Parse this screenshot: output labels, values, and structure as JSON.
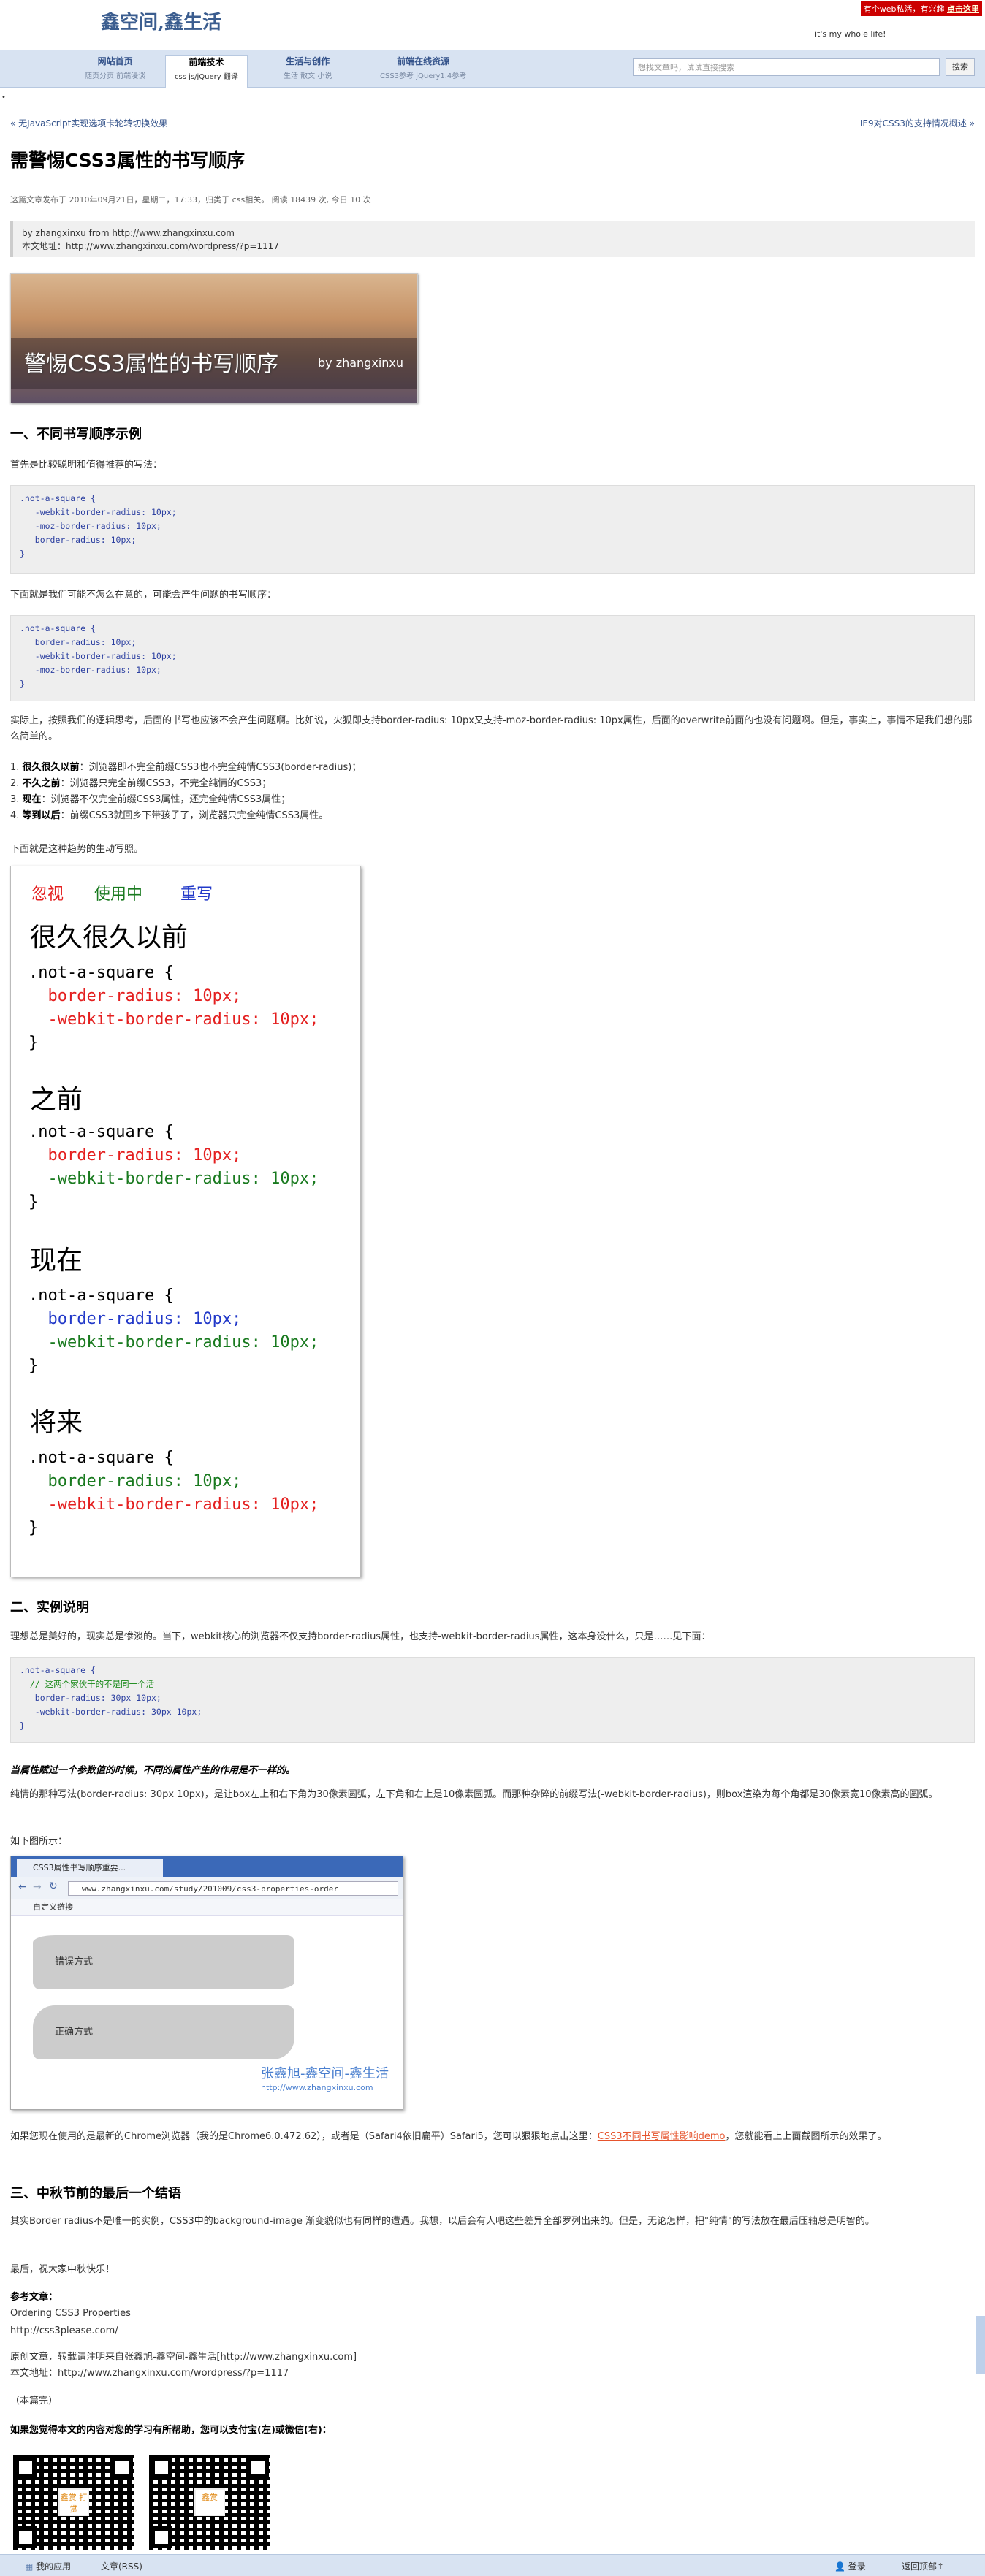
{
  "header": {
    "logo_text": "鑫空间,鑫生活",
    "promo_text": "有个web私活，有兴趣",
    "promo_link": "点击这里",
    "slogan": "it's my whole life!",
    "nav": [
      {
        "title": "网站首页",
        "sub": "随页分页  前端漫谈"
      },
      {
        "title": "前端技术",
        "sub": "css  js/jQuery  翻译"
      },
      {
        "title": "生活与创作",
        "sub": "生活  散文  小说"
      },
      {
        "title": "前端在线资源",
        "sub": "CSS3参考  jQuery1.4参考"
      }
    ],
    "search_placeholder": "想找文章吗，试试直接搜索",
    "search_button": "搜索"
  },
  "article": {
    "prev": "« 无JavaScript实现选项卡轮转切换效果",
    "next": "IE9对CSS3的支持情况概述 »",
    "title": "需警惕CSS3属性的书写顺序",
    "meta": "这篇文章发布于 2010年09月21日，星期二，17:33，归类于 css相关。 阅读 18439 次, 今日 10 次",
    "byline_1": "by zhangxinxu from http://www.zhangxinxu.com",
    "byline_2": "本文地址：http://www.zhangxinxu.com/wordpress/?p=1117",
    "banner_title": "警惕CSS3属性的书写顺序",
    "banner_by": "by zhangxinxu",
    "s1_title": "一、不同书写顺序示例",
    "s1_p1": "首先是比较聪明和值得推荐的写法：",
    "code1": ".not-a-square {\n   -webkit-border-radius: 10px;\n   -moz-border-radius: 10px;\n   border-radius: 10px;\n}",
    "s1_p2": "下面就是我们可能不怎么在意的，可能会产生问题的书写顺序：",
    "code2": ".not-a-square {\n   border-radius: 10px;\n   -webkit-border-radius: 10px;\n   -moz-border-radius: 10px;\n}",
    "s1_p3": "实际上，按照我们的逻辑思考，后面的书写也应该不会产生问题啊。比如说，火狐即支持border-radius: 10px又支持-moz-border-radius: 10px属性，后面的overwrite前面的也没有问题啊。但是，事实上，事情不是我们想的那么简单的。",
    "list": [
      {
        "b": "很久很久以前",
        "t": "：浏览器即不完全前缀CSS3也不完全纯情CSS3(border-radius)；"
      },
      {
        "b": "不久之前",
        "t": "：浏览器只完全前缀CSS3，不完全纯情的CSS3；"
      },
      {
        "b": "现在",
        "t": "：浏览器不仅完全前缀CSS3属性，还完全纯情CSS3属性；"
      },
      {
        "b": "等到以后",
        "t": "：前缀CSS3就回乡下带孩子了，浏览器只完全纯情CSS3属性。"
      }
    ],
    "s1_p4": "下面就是这种趋势的生动写照。",
    "fig": {
      "legend_ignored": "忽视",
      "legend_used": "使用中",
      "legend_override": "重写",
      "era_1": "很久很久以前",
      "era_2": "之前",
      "era_3": "现在",
      "era_4": "将来",
      "selector": ".not-a-square {",
      "close": "}",
      "prop_std": "border-radius: 10px;",
      "prop_webkit": "-webkit-border-radius: 10px;"
    },
    "s2_title": "二、实例说明",
    "s2_p1": "理想总是美好的，现实总是惨淡的。当下，webkit核心的浏览器不仅支持border-radius属性，也支持-webkit-border-radius属性，这本身没什么，只是……见下面：",
    "code3_comment": "  // 这两个家伙干的不是同一个活",
    "code3_a": ".not-a-square {",
    "code3_b": "   border-radius: 30px 10px;",
    "code3_c": "   -webkit-border-radius: 30px 10px;",
    "code3_d": "}",
    "s2_note": "当属性赋过一个参数值的时候，不同的属性产生的作用是不一样的。",
    "s2_p2": "纯情的那种写法(border-radius: 30px 10px)，是让box左上和右下角为30像素圆弧，左下角和右上是10像素圆弧。而那种杂碎的前缀写法(-webkit-border-radius)，则box渲染为每个角都是30像素宽10像素高的圆弧。",
    "s2_p3": "如下图所示：",
    "browser": {
      "tab": "CSS3属性书写顺序重要...",
      "url": "www.zhangxinxu.com/study/201009/css3-properties-order",
      "bookmark": "自定义链接",
      "box1": "错误方式",
      "box2": "正确方式",
      "sig": "张鑫旭-鑫空间-鑫生活",
      "sigurl": "http://www.zhangxinxu.com"
    },
    "s2_p4a": "如果您现在使用的是最新的Chrome浏览器（我的是Chrome6.0.472.62），或者是（Safari4依旧扁平）Safari5，您可以狠狠地点击这里：",
    "s2_p4_link": "CSS3不同书写属性影响demo",
    "s2_p4b": "，您就能看上上面截图所示的效果了。",
    "s3_title": "三、中秋节前的最后一个结语",
    "s3_p1": "其实Border radius不是唯一的实例，CSS3中的background-image 渐变貌似也有同样的遭遇。我想，以后会有人吧这些差异全部罗列出来的。但是，无论怎样，把\"纯情\"的写法放在最后压轴总是明智的。",
    "s3_p2": "最后，祝大家中秋快乐！",
    "refs_label": "参考文章：",
    "ref1": "Ordering CSS3 Properties",
    "ref2": "http://css3please.com/",
    "copy1": "原创文章，转载请注明来自张鑫旭-鑫空间-鑫生活[http://www.zhangxinxu.com]",
    "copy2": "本文地址：http://www.zhangxinxu.com/wordpress/?p=1117",
    "end": "（本篇完）",
    "donate": "如果您觉得本文的内容对您的学习有所帮助，您可以支付宝(左)或微信(右)：",
    "qr_left_label": "鑫赏\n打赏",
    "qr_right_label": "鑫赏"
  },
  "bottombar": {
    "app": "我的应用",
    "rss": "文章(RSS)",
    "login": "登录",
    "top": "返回顶部↑"
  }
}
